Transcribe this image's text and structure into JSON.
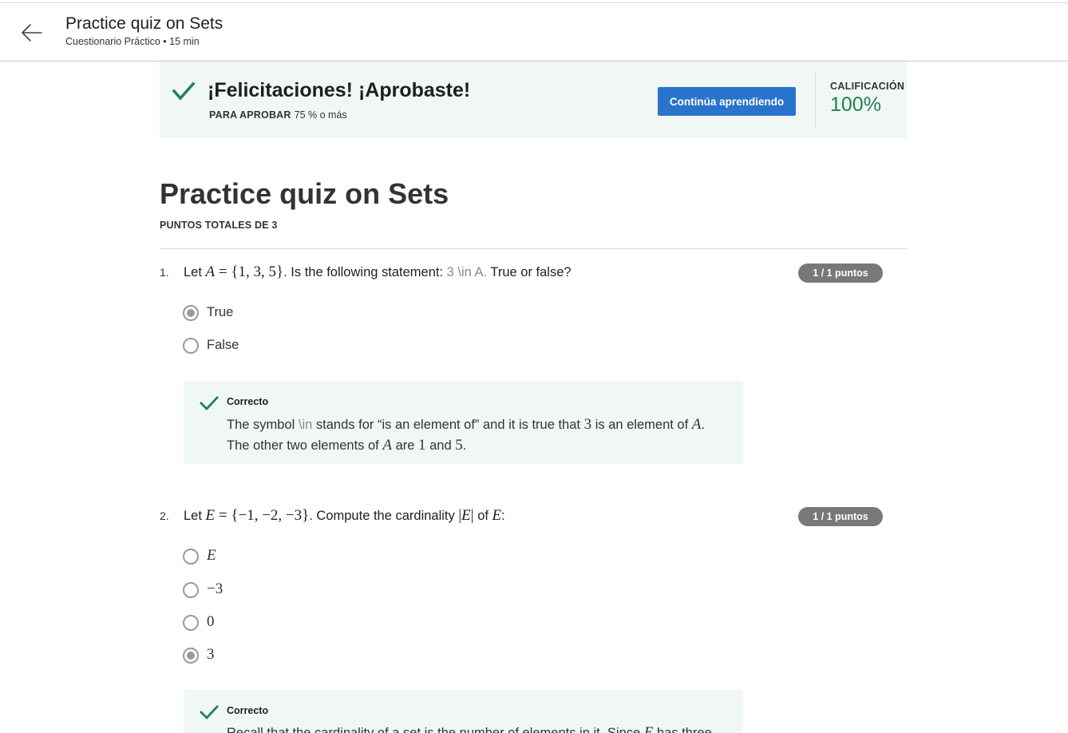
{
  "header": {
    "title": "Practice quiz on Sets",
    "subtitle": "Cuestionario Práctico • 15 min"
  },
  "banner": {
    "title": "¡Felicitaciones! ¡Aprobaste!",
    "pass_label": "PARA APROBAR",
    "pass_value": "75 % o más",
    "continue_label": "Continúa aprendiendo",
    "grade_label": "CALIFICACIÓN",
    "grade_value": "100%",
    "accent_color": "#1f8354",
    "button_color": "#2a73cc"
  },
  "quiz": {
    "title": "Practice quiz on Sets",
    "total_points": "PUNTOS TOTALES DE 3"
  },
  "questions": [
    {
      "number": "1.",
      "points": "1 / 1 puntos",
      "prefix": "Let",
      "set_lhs": "A",
      "set_rhs": "= {1, 3, 5}",
      "middle": ". Is the following statement:",
      "code": "3 \\in A.",
      "suffix": "True or false?",
      "options": [
        {
          "label": "True",
          "selected": true
        },
        {
          "label": "False",
          "selected": false
        }
      ],
      "feedback": {
        "title": "Correcto",
        "line1_a": "The symbol",
        "line1_code": "\\in",
        "line1_b": "stands for “is an element of” and it is true that",
        "line1_num": "3",
        "line1_c": "is an element of",
        "line1_var": "A",
        "line1_end": ".",
        "line2_a": "The other two elements of",
        "line2_var": "A",
        "line2_b": "are",
        "line2_num1": "1",
        "line2_c": "and",
        "line2_num2": "5",
        "line2_end": "."
      }
    },
    {
      "number": "2.",
      "points": "1 / 1 puntos",
      "prefix": "Let",
      "set_lhs": "E",
      "set_rhs": "= {−1, −2, −3}",
      "middle": ". Compute the cardinality",
      "card_open": "|",
      "card_var": "E",
      "card_close": "|",
      "of_text": "of",
      "of_var": "E",
      "suffix": ":",
      "options": [
        {
          "label": "E",
          "selected": false
        },
        {
          "label": "−3",
          "selected": false
        },
        {
          "label": "0",
          "selected": false
        },
        {
          "label": "3",
          "selected": true
        }
      ],
      "feedback": {
        "title": "Correcto",
        "line1_a": "Recall that the cardinality of a set is the number of elements in it. Since",
        "line1_var": "E",
        "line1_b": "has three"
      }
    }
  ]
}
